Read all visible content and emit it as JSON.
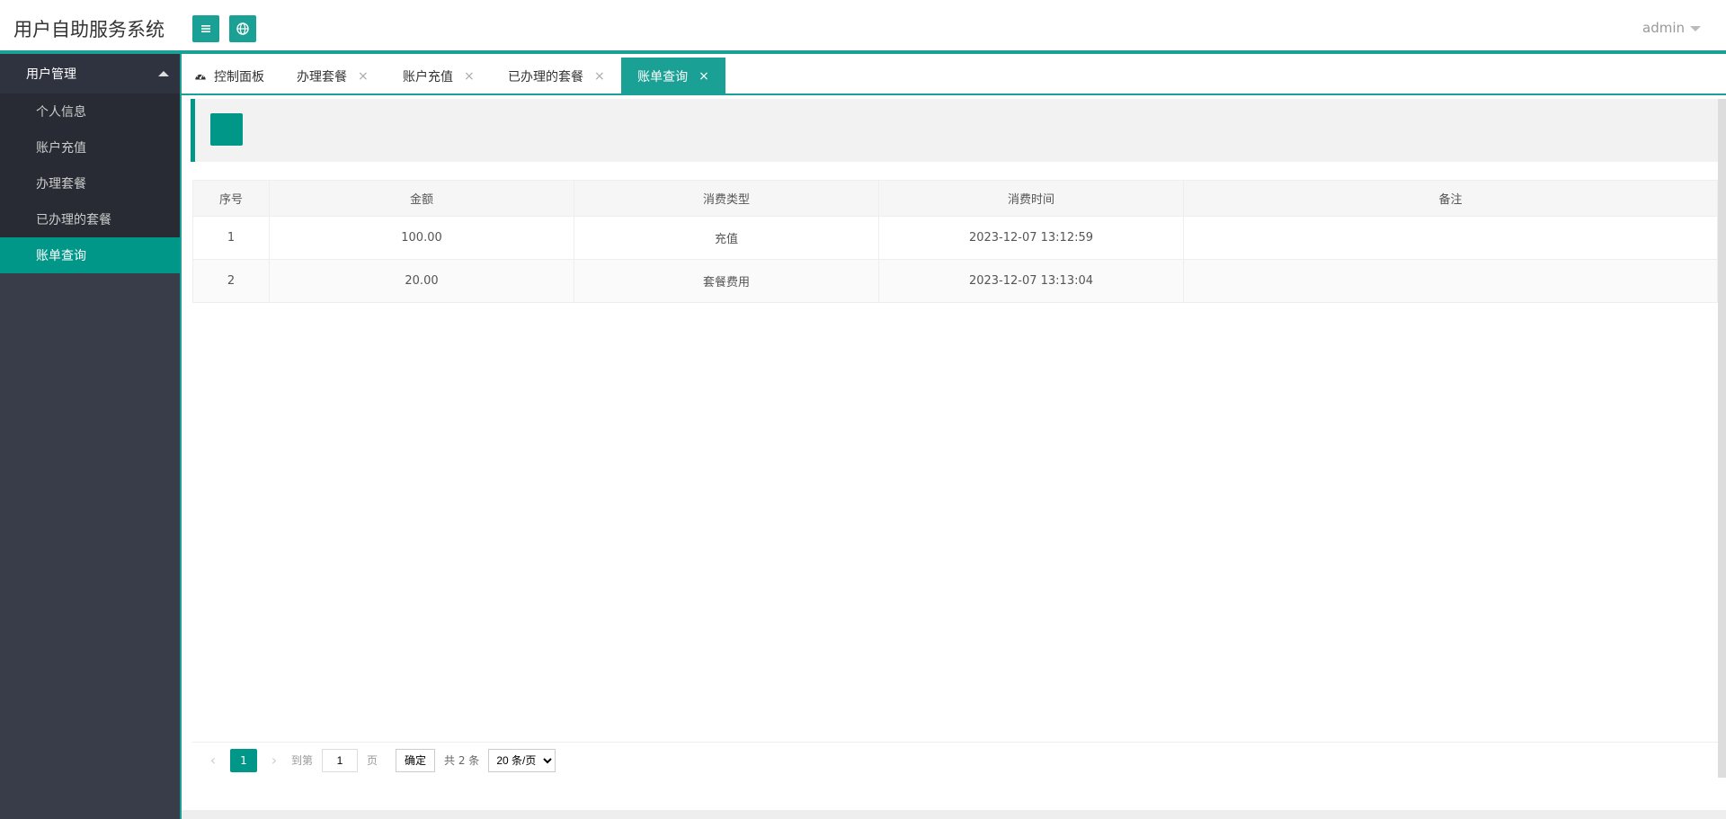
{
  "app": {
    "title": "用户自助服务系统",
    "user": "admin"
  },
  "sidebar": {
    "group": "用户管理",
    "items": [
      {
        "label": "个人信息"
      },
      {
        "label": "账户充值"
      },
      {
        "label": "办理套餐"
      },
      {
        "label": "已办理的套餐"
      },
      {
        "label": "账单查询"
      }
    ]
  },
  "tabs": [
    {
      "label": "控制面板"
    },
    {
      "label": "办理套餐",
      "close": "×"
    },
    {
      "label": "账户充值",
      "close": "×"
    },
    {
      "label": "已办理的套餐",
      "close": "×"
    },
    {
      "label": "账单查询",
      "close": "×"
    }
  ],
  "table": {
    "headers": [
      "序号",
      "金额",
      "消费类型",
      "消费时间",
      "备注"
    ],
    "rows": [
      [
        "1",
        "100.00",
        "充值",
        "2023-12-07 13:12:59",
        ""
      ],
      [
        "2",
        "20.00",
        "套餐费用",
        "2023-12-07 13:13:04",
        ""
      ]
    ]
  },
  "pager": {
    "prev": "‹",
    "current": "1",
    "next": "›",
    "goto_label": "到第",
    "goto_value": "1",
    "page_suffix": "页",
    "confirm": "确定",
    "total": "共 2 条",
    "page_size": "20 条/页"
  },
  "colors": {
    "accent": "#009688",
    "header_accent": "#1aa094",
    "sidebar_bg": "#393d49"
  }
}
